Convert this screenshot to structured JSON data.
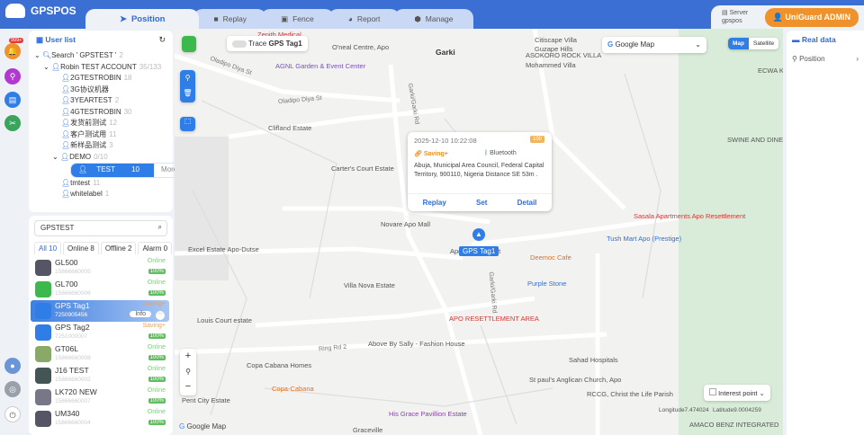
{
  "app": {
    "name": "GPSPOS"
  },
  "tabs": [
    {
      "label": "Position",
      "icon": "send-icon"
    },
    {
      "label": "Replay",
      "icon": "video-icon"
    },
    {
      "label": "Fence",
      "icon": "fence-icon"
    },
    {
      "label": "Report",
      "icon": "pie-chart-icon"
    },
    {
      "label": "Manage",
      "icon": "cube-icon"
    }
  ],
  "header": {
    "server_label": "Server",
    "server_value": "gpspos",
    "user": "UniGuard ADMIN"
  },
  "rail": {
    "badge": "999+"
  },
  "userlist": {
    "title": "User list",
    "search": "Search ' GPSTEST '",
    "search_count": "2",
    "root": {
      "name": "Robin TEST ACCOUNT",
      "count": "35/133"
    },
    "children": [
      {
        "name": "2GTESTROBIN",
        "count": "18"
      },
      {
        "name": "3G协议机器",
        "count": ""
      },
      {
        "name": "3YEARTEST",
        "count": "2"
      },
      {
        "name": "4GTESTROBIN",
        "count": "30"
      },
      {
        "name": "发货前测试",
        "count": "12"
      },
      {
        "name": "客户测试用",
        "count": "11"
      },
      {
        "name": "新样品测试",
        "count": "3"
      }
    ],
    "demo": {
      "name": "DEMO",
      "count": "0/10"
    },
    "selected": {
      "name": "TEST",
      "count": "10",
      "more": "More"
    },
    "after": [
      {
        "name": "tmtest",
        "count": "11"
      },
      {
        "name": "whitelabel",
        "count": "1"
      }
    ]
  },
  "devices": {
    "search_value": "GPSTEST",
    "filters": [
      {
        "label": "All 10"
      },
      {
        "label": "Online 8"
      },
      {
        "label": "Offline 2"
      },
      {
        "label": "Alarm 0"
      }
    ],
    "items": [
      {
        "name": "GL500",
        "id": "15866660005",
        "status": "Online",
        "battery": "100%"
      },
      {
        "name": "GL700",
        "id": "15866660006",
        "status": "Online",
        "battery": "100%"
      },
      {
        "name": "GPS Tag1",
        "id": "7250905456",
        "status": "Saving+",
        "info": "Info",
        "more": "···"
      },
      {
        "name": "GPS Tag2",
        "id": "7251000007",
        "status": "Saving+",
        "battery": "100%"
      },
      {
        "name": "GT06L",
        "id": "15866660008",
        "status": "Online",
        "battery": "100%"
      },
      {
        "name": "J16 TEST",
        "id": "15866660002",
        "status": "Online",
        "battery": "100%"
      },
      {
        "name": "LK720 NEW",
        "id": "15866660007",
        "status": "Online",
        "battery": "100%"
      },
      {
        "name": "UM340",
        "id": "15866660004",
        "status": "Online",
        "battery": "100%"
      }
    ]
  },
  "map": {
    "trace_label": "Trace",
    "trace_device": "GPS Tag1",
    "provider": "Google Map",
    "map_btn": "Map",
    "satellite_btn": "Satellite",
    "interest": "Interest point",
    "longitude": "Longitude7.474024",
    "latitude": "Latitude9.0004259",
    "attribution": "Google Map",
    "marker_label": "GPS Tag1",
    "labels": [
      "Zenith Medical",
      "O'neal Centre, Apo",
      "Citiscape Villa",
      "Guzape Hills",
      "Garki",
      "ASOKORO ROCK VILLA",
      "Mohammed Villa",
      "AGNL Garden & Event Center",
      "Clifland Estate",
      "Carter's Court Estate",
      "Novare Apo Mall",
      "Excel Estate Apo-Dutse",
      "Apo Ultra Market",
      "Deemoc Cafe",
      "Purple Stone",
      "Villa Nova Estate",
      "Louis Court estate",
      "Above By Sally - Fashion House",
      "APO RESETTLEMENT AREA",
      "Copa Cabana Homes",
      "Copa-Cabana",
      "Pent City Estate",
      "St paul's Anglican Church, Apo",
      "Sahad Hospitals",
      "RCCG, Christ the Life Parish",
      "His Grace Pavillion Estate",
      "Sasala Apartments Apo Resettlement",
      "Tush Mart Apo (Prestige)",
      "SWINE AND DINE",
      "ECWA KOBI M",
      "AMACO BENZ INTEGRATED",
      "Graceville"
    ],
    "roads": [
      "Oladipo Diya St",
      "Oladipo Diya St",
      "Garki/Garki Rd",
      "Garki/Garki Rd",
      "Ring Rd 2"
    ]
  },
  "popup": {
    "time": "2025-12-10 10:22:08",
    "battery": "100",
    "mode": "Saving+",
    "conn": "Bluetooth",
    "address": "Abuja, Municipal Area Council, Federal Capital Territory, 900110, Nigeria Distance SE 53m .",
    "replay": "Replay",
    "set": "Set",
    "detail": "Detail"
  },
  "right": {
    "title": "Real data",
    "position": "Position"
  }
}
